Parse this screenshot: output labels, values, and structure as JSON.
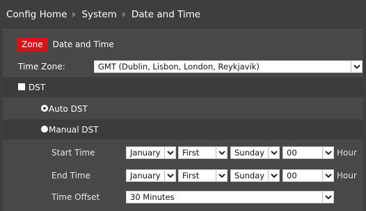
{
  "breadcrumb": {
    "items": [
      "Config Home",
      "System",
      "Date and Time"
    ]
  },
  "tabs": [
    {
      "label": "Zone",
      "active": true
    },
    {
      "label": "Date and Time",
      "active": false
    }
  ],
  "timezone": {
    "label": "Time Zone:",
    "value": "GMT (Dublin, Lisbon, London, Reykjavik)"
  },
  "dst": {
    "label": "DST",
    "checked": false
  },
  "auto_dst": {
    "label": "Auto DST",
    "selected": true
  },
  "manual_dst": {
    "label": "Manual DST",
    "selected": false
  },
  "start_time": {
    "label": "Start Time",
    "month": "January",
    "week": "First",
    "day": "Sunday",
    "hour": "00",
    "unit": "Hour"
  },
  "end_time": {
    "label": "End Time",
    "month": "January",
    "week": "First",
    "day": "Sunday",
    "hour": "00",
    "unit": "Hour"
  },
  "time_offset": {
    "label": "Time Offset",
    "value": "30 Minutes"
  },
  "colors": {
    "accent": "#d2141b",
    "background": "#3e3e3e",
    "panel": "#484848",
    "row_dark": "#3c3c3c"
  }
}
